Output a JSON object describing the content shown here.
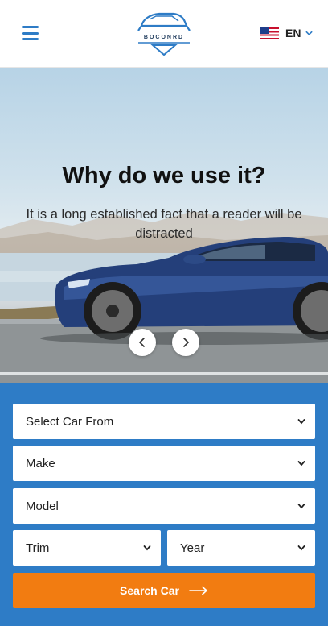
{
  "header": {
    "logo_text": "BOCONRD",
    "language": {
      "label": "EN"
    }
  },
  "hero": {
    "title": "Why do we use it?",
    "subtitle": "It is a long established fact that a reader will be distracted"
  },
  "search": {
    "fields": {
      "car_from": "Select Car From",
      "make": "Make",
      "model": "Model",
      "trim": "Trim",
      "year": "Year"
    },
    "button_label": "Search Car"
  },
  "colors": {
    "brand_blue": "#2e7cc6",
    "accent_orange": "#f27c11"
  },
  "icons": {
    "menu": "hamburger-menu-icon",
    "flag": "us-flag-icon",
    "dropdown": "chevron-down-icon",
    "prev": "chevron-left-icon",
    "next": "chevron-right-icon",
    "search_arrow": "arrow-right-icon"
  }
}
